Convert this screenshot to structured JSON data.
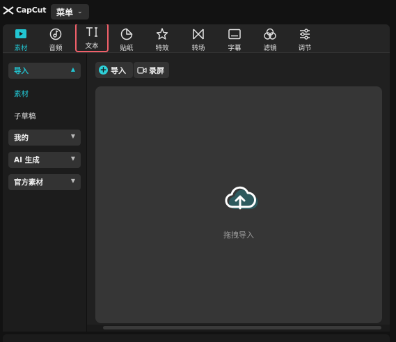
{
  "app": {
    "logo_text": "CapCut",
    "menu_label": "菜单"
  },
  "toolbar": {
    "items": [
      {
        "label": "素材",
        "icon": "media-icon",
        "active": true
      },
      {
        "label": "音频",
        "icon": "audio-icon"
      },
      {
        "label": "文本",
        "icon": "text-icon",
        "highlighted": true
      },
      {
        "label": "贴纸",
        "icon": "sticker-icon"
      },
      {
        "label": "特效",
        "icon": "effects-icon"
      },
      {
        "label": "转场",
        "icon": "transition-icon"
      },
      {
        "label": "字幕",
        "icon": "captions-icon"
      },
      {
        "label": "滤镜",
        "icon": "filter-icon"
      },
      {
        "label": "调节",
        "icon": "adjust-icon"
      }
    ]
  },
  "sidebar": {
    "sections": [
      {
        "label": "导入",
        "open": true,
        "items": [
          {
            "label": "素材",
            "active": true
          },
          {
            "label": "子草稿"
          }
        ]
      },
      {
        "label": "我的"
      },
      {
        "label": "AI 生成"
      },
      {
        "label": "官方素材"
      }
    ]
  },
  "content": {
    "import_label": "导入",
    "record_label": "录屏",
    "drop_text": "拖拽导入"
  },
  "colors": {
    "accent": "#22c5d2",
    "highlight_border": "#f0606a"
  }
}
